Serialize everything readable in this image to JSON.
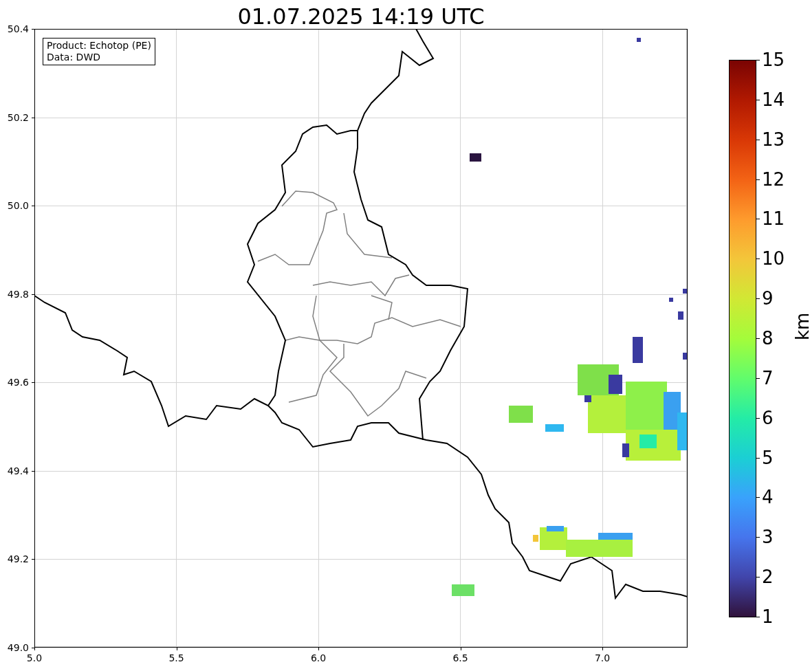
{
  "title": "01.07.2025 14:19 UTC",
  "legend": [
    "Product: Echotop (PE)",
    "Data: DWD"
  ],
  "x_ticks": [
    "5.0",
    "5.5",
    "6.0",
    "6.5",
    "7.0"
  ],
  "y_ticks": [
    "50.4",
    "50.2",
    "50.0",
    "49.8",
    "49.6",
    "49.4",
    "49.2",
    "49.0"
  ],
  "colorbar": {
    "label": "km",
    "ticks": [
      "15",
      "14",
      "13",
      "12",
      "11",
      "10",
      "9",
      "8",
      "7",
      "6",
      "5",
      "4",
      "3",
      "2",
      "1"
    ]
  }
}
